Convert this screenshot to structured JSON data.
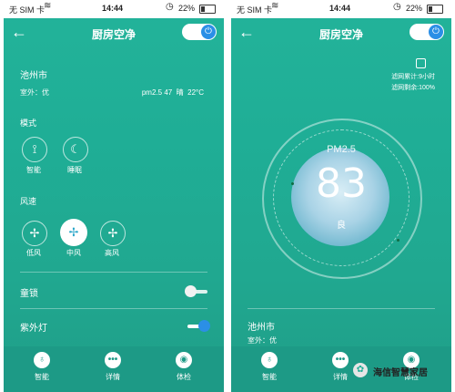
{
  "status_bar": {
    "carrier": "无 SIM 卡",
    "time": "14:44",
    "battery": "22%"
  },
  "header": {
    "title": "厨房空净"
  },
  "location": {
    "city": "池州市",
    "outdoor_label": "室外：优",
    "pm_text": "pm2.5 47",
    "weather": "晴",
    "temp": "22°C"
  },
  "mode": {
    "section_title": "模式",
    "items": [
      {
        "label": "智能",
        "icon": "smart-mode-icon"
      },
      {
        "label": "睡眠",
        "icon": "sleep-mode-icon"
      }
    ]
  },
  "fan": {
    "section_title": "风速",
    "items": [
      {
        "label": "低风",
        "icon": "fan-low-icon",
        "active": false
      },
      {
        "label": "中风",
        "icon": "fan-mid-icon",
        "active": true
      },
      {
        "label": "高风",
        "icon": "fan-high-icon",
        "active": false
      }
    ]
  },
  "child_lock": {
    "label": "童锁",
    "on": false
  },
  "uv_lamp": {
    "label": "紫外灯",
    "on": true
  },
  "tabs": [
    {
      "label": "智能",
      "icon": "bulb-icon"
    },
    {
      "label": "详情",
      "icon": "more-icon"
    },
    {
      "label": "体检",
      "icon": "checkup-icon"
    }
  ],
  "detail": {
    "filter_used": "滤网累计:9小时",
    "filter_remaining": "滤网剩余:100%",
    "pm_label": "PM2.5",
    "pm_value": "83",
    "pm_grade": "良",
    "city": "池州市",
    "outdoor_label": "室外：优"
  },
  "watermark": {
    "text": "海信智慧家居"
  },
  "colors": {
    "background": "#1fae96",
    "accent": "#2b8fe6"
  }
}
